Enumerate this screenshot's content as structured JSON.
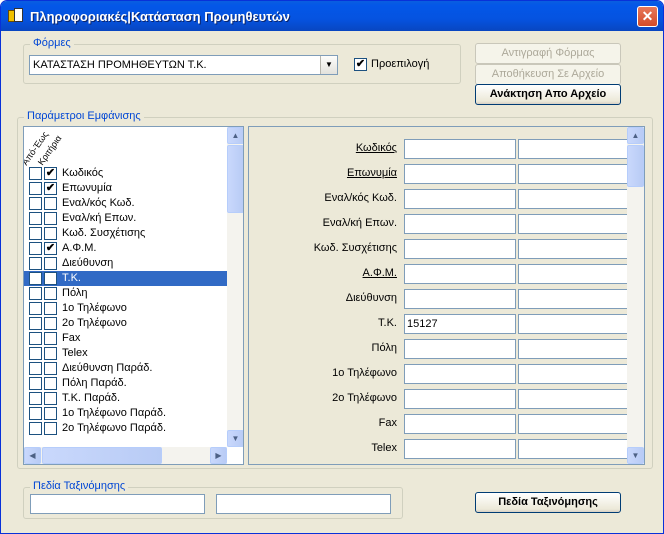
{
  "window": {
    "title": "Πληροφοριακές|Κατάσταση Προμηθευτών",
    "close_label": "✕"
  },
  "forms_group": {
    "title": "Φόρμες",
    "combo_value": "ΚΑΤΑΣΤΑΣΗ ΠΡΟΜΗΘΕΥΤΩΝ Τ.Κ.",
    "default_label": "Προεπιλογή",
    "default_checked": true
  },
  "buttons": {
    "copy_form": "Αντιγραφή Φόρμας",
    "save_to_file": "Αποθήκευση Σε Αρχείο",
    "load_from_file": "Ανάκτηση Απο Αρχείο",
    "sort_fields": "Πεδία Ταξινόμησης"
  },
  "display_group": {
    "title": "Παράμετροι Εμφάνισης",
    "col_header_1": "Από-Έως",
    "col_header_2": "Κριτήρια",
    "items": [
      {
        "label": "Κωδικός",
        "fromto": false,
        "criteria": true
      },
      {
        "label": "Επωνυμία",
        "fromto": false,
        "criteria": true
      },
      {
        "label": "Εναλ/κός Κωδ.",
        "fromto": false,
        "criteria": false
      },
      {
        "label": "Εναλ/κή Επων.",
        "fromto": false,
        "criteria": false
      },
      {
        "label": "Κωδ. Συσχέτισης",
        "fromto": false,
        "criteria": false
      },
      {
        "label": "Α.Φ.Μ.",
        "fromto": false,
        "criteria": true
      },
      {
        "label": "Διεύθυνση",
        "fromto": false,
        "criteria": false
      },
      {
        "label": "Τ.Κ.",
        "fromto": false,
        "criteria": true,
        "selected": true
      },
      {
        "label": "Πόλη",
        "fromto": false,
        "criteria": false
      },
      {
        "label": "1ο Τηλέφωνο",
        "fromto": false,
        "criteria": false
      },
      {
        "label": "2ο Τηλέφωνο",
        "fromto": false,
        "criteria": false
      },
      {
        "label": "Fax",
        "fromto": false,
        "criteria": false
      },
      {
        "label": "Telex",
        "fromto": false,
        "criteria": false
      },
      {
        "label": "Διεύθυνση Παράδ.",
        "fromto": false,
        "criteria": false
      },
      {
        "label": "Πόλη Παράδ.",
        "fromto": false,
        "criteria": false
      },
      {
        "label": "Τ.Κ. Παράδ.",
        "fromto": false,
        "criteria": false
      },
      {
        "label": "1ο Τηλέφωνο Παράδ.",
        "fromto": false,
        "criteria": false
      },
      {
        "label": "2ο Τηλέφωνο Παράδ.",
        "fromto": false,
        "criteria": false
      }
    ],
    "fields": [
      {
        "label": "Κωδικός",
        "underline": true,
        "value1": "",
        "value2": ""
      },
      {
        "label": "Επωνυμία",
        "underline": true,
        "value1": "",
        "value2": ""
      },
      {
        "label": "Εναλ/κός Κωδ.",
        "underline": false,
        "value1": "",
        "value2": ""
      },
      {
        "label": "Εναλ/κή Επων.",
        "underline": false,
        "value1": "",
        "value2": ""
      },
      {
        "label": "Κωδ. Συσχέτισης",
        "underline": false,
        "value1": "",
        "value2": ""
      },
      {
        "label": "Α.Φ.Μ.",
        "underline": true,
        "value1": "",
        "value2": ""
      },
      {
        "label": "Διεύθυνση",
        "underline": false,
        "value1": "",
        "value2": ""
      },
      {
        "label": "Τ.Κ.",
        "underline": false,
        "value1": "15127",
        "value2": ""
      },
      {
        "label": "Πόλη",
        "underline": false,
        "value1": "",
        "value2": ""
      },
      {
        "label": "1ο Τηλέφωνο",
        "underline": false,
        "value1": "",
        "value2": ""
      },
      {
        "label": "2ο Τηλέφωνο",
        "underline": false,
        "value1": "",
        "value2": ""
      },
      {
        "label": "Fax",
        "underline": false,
        "value1": "",
        "value2": ""
      },
      {
        "label": "Telex",
        "underline": false,
        "value1": "",
        "value2": ""
      }
    ]
  },
  "sort_group": {
    "title": "Πεδία Ταξινόμησης",
    "field1": "",
    "field2": ""
  },
  "icons": {
    "check": "✔",
    "arrow_up": "▲",
    "arrow_down": "▼",
    "arrow_left": "◀",
    "arrow_right": "▶"
  },
  "colors": {
    "title_bar": "#0553e0",
    "group_title": "#0046d5",
    "selection": "#316ac5"
  }
}
